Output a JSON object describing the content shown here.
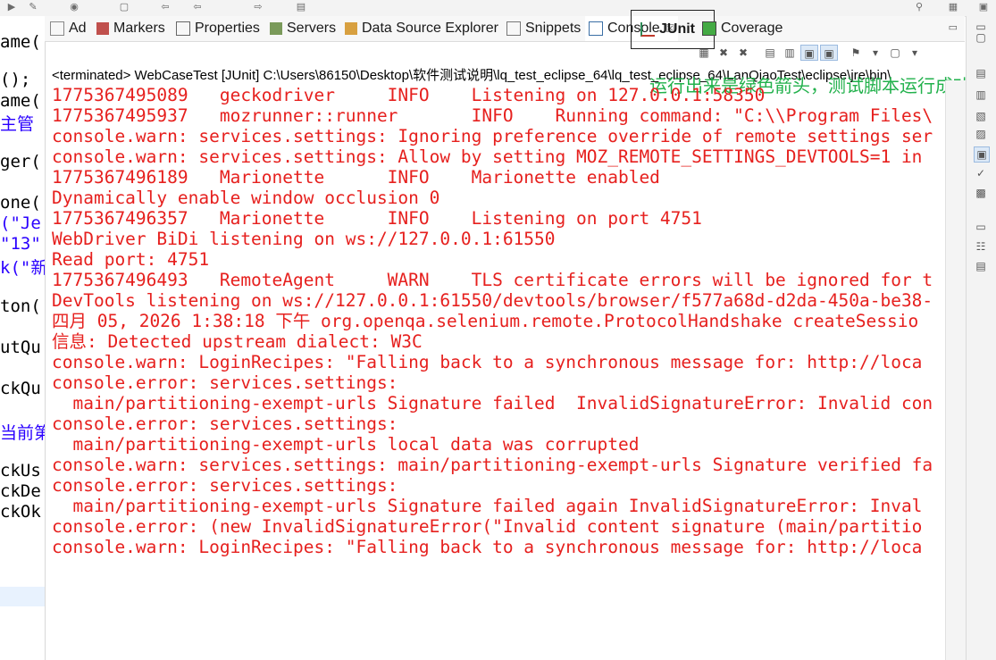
{
  "toolbar": {
    "icons": [
      "run-icon",
      "debug-icon",
      "globe-icon",
      "new-icon",
      "back-icon",
      "forward-icon",
      "task-icon"
    ],
    "search_icon": "search-icon"
  },
  "editor_fragments": [
    {
      "text": "ame(",
      "color": "black"
    },
    {
      "text": "();",
      "color": "black"
    },
    {
      "text": "ame(",
      "color": "black"
    },
    {
      "text": "主管",
      "color": "blue"
    },
    {
      "text": "ger(",
      "color": "black"
    },
    {
      "text": "one(",
      "color": "black"
    },
    {
      "text": "(\"Je",
      "color": "blue"
    },
    {
      "text": "\"13\"",
      "color": "blue"
    },
    {
      "text": "k(\"新",
      "color": "blue"
    },
    {
      "text": "ton(",
      "color": "black"
    },
    {
      "text": "utQu",
      "color": "black"
    },
    {
      "text": "ckQu",
      "color": "black"
    },
    {
      "text": "当前第",
      "color": "blue"
    },
    {
      "text": "ckUs",
      "color": "black"
    },
    {
      "text": "ckDe",
      "color": "black"
    },
    {
      "text": "ckOk",
      "color": "black"
    }
  ],
  "tabs": [
    {
      "label": "Ad",
      "icon": "problems-icon"
    },
    {
      "label": "Markers",
      "icon": "markers-icon"
    },
    {
      "label": "Properties",
      "icon": "properties-icon"
    },
    {
      "label": "Servers",
      "icon": "servers-icon"
    },
    {
      "label": "Data Source Explorer",
      "icon": "datasource-icon"
    },
    {
      "label": "Snippets",
      "icon": "snippets-icon"
    },
    {
      "label": "Console",
      "icon": "console-icon",
      "close": "☒"
    },
    {
      "label": "JUnit",
      "icon": "junit-icon"
    },
    {
      "label": "Coverage",
      "icon": "coverage-icon"
    }
  ],
  "console": {
    "terminated_line": "<terminated> WebCaseTest [JUnit] C:\\Users\\86150\\Desktop\\软件测试说明\\lq_test_eclipse_64\\lq_test_eclipse_64\\LanQiaoTest\\eclipse\\jre\\bin\\",
    "overlay_note": "运行出来是绿色箭头，测试脚本运行成功",
    "lines": [
      "1775367495089   geckodriver     INFO    Listening on 127.0.0.1:58350",
      "1775367495937   mozrunner::runner       INFO    Running command: \"C:\\\\Program Files\\",
      "console.warn: services.settings: Ignoring preference override of remote settings ser",
      "console.warn: services.settings: Allow by setting MOZ_REMOTE_SETTINGS_DEVTOOLS=1 in",
      "1775367496189   Marionette      INFO    Marionette enabled",
      "Dynamically enable window occlusion 0",
      "1775367496357   Marionette      INFO    Listening on port 4751",
      "WebDriver BiDi listening on ws://127.0.0.1:61550",
      "Read port: 4751",
      "1775367496493   RemoteAgent     WARN    TLS certificate errors will be ignored for t",
      "DevTools listening on ws://127.0.0.1:61550/devtools/browser/f577a68d-d2da-450a-be38-",
      "四月 05, 2026 1:38:18 下午 org.openqa.selenium.remote.ProtocolHandshake createSessio",
      "信息: Detected upstream dialect: W3C",
      "console.warn: LoginRecipes: \"Falling back to a synchronous message for: http://loca",
      "console.error: services.settings:",
      "  main/partitioning-exempt-urls Signature failed  InvalidSignatureError: Invalid con",
      "console.error: services.settings:",
      "  main/partitioning-exempt-urls local data was corrupted",
      "console.warn: services.settings: main/partitioning-exempt-urls Signature verified fa",
      "console.error: services.settings:",
      "  main/partitioning-exempt-urls Signature failed again InvalidSignatureError: Inval",
      "console.error: (new InvalidSignatureError(\"Invalid content signature (main/partitio",
      "console.warn: LoginRecipes: \"Falling back to a synchronous message for: http://loca"
    ]
  },
  "console_tools": [
    "clear-icon",
    "terminate-icon",
    "remove-all-icon",
    "scroll-lock-icon",
    "word-wrap-icon",
    "show-on-stdout-icon",
    "show-on-stderr-icon",
    "pin-icon",
    "display-console-icon",
    "new-console-icon",
    "view-menu-icon"
  ],
  "trim_icons": [
    "minimize-icon",
    "maximize-icon",
    "outline-icon",
    "task-list-icon",
    "doc-icon",
    "console-icon",
    "junit-icon",
    "coverage-icon",
    "restore-icon",
    "hierarchy-icon",
    "notes-icon"
  ],
  "colors": {
    "console_text": "#e6201e",
    "note_green": "#22b14c"
  }
}
